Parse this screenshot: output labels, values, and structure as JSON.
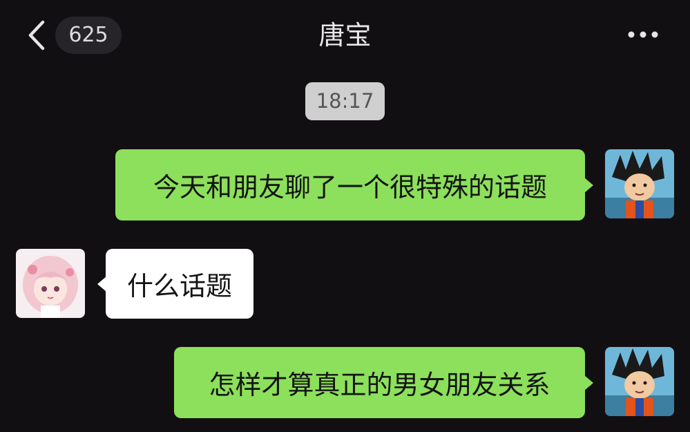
{
  "header": {
    "back_icon": "chevron-left-icon",
    "unread_count": "625",
    "title": "唐宝",
    "more_icon": "ellipsis-icon"
  },
  "chat": {
    "timestamp": "18:17",
    "messages": [
      {
        "side": "sent",
        "text": "今天和朋友聊了一个很特殊的话题",
        "avatar": "goku-avatar"
      },
      {
        "side": "received",
        "text": "什么话题",
        "avatar": "anime-girl-avatar"
      },
      {
        "side": "sent",
        "text": "怎样才算真正的男女朋友关系",
        "avatar": "goku-avatar"
      }
    ]
  },
  "colors": {
    "background": "#120f13",
    "sent_bubble": "#8ce05b",
    "received_bubble": "#ffffff",
    "timestamp_bg": "#cfcfcf"
  }
}
